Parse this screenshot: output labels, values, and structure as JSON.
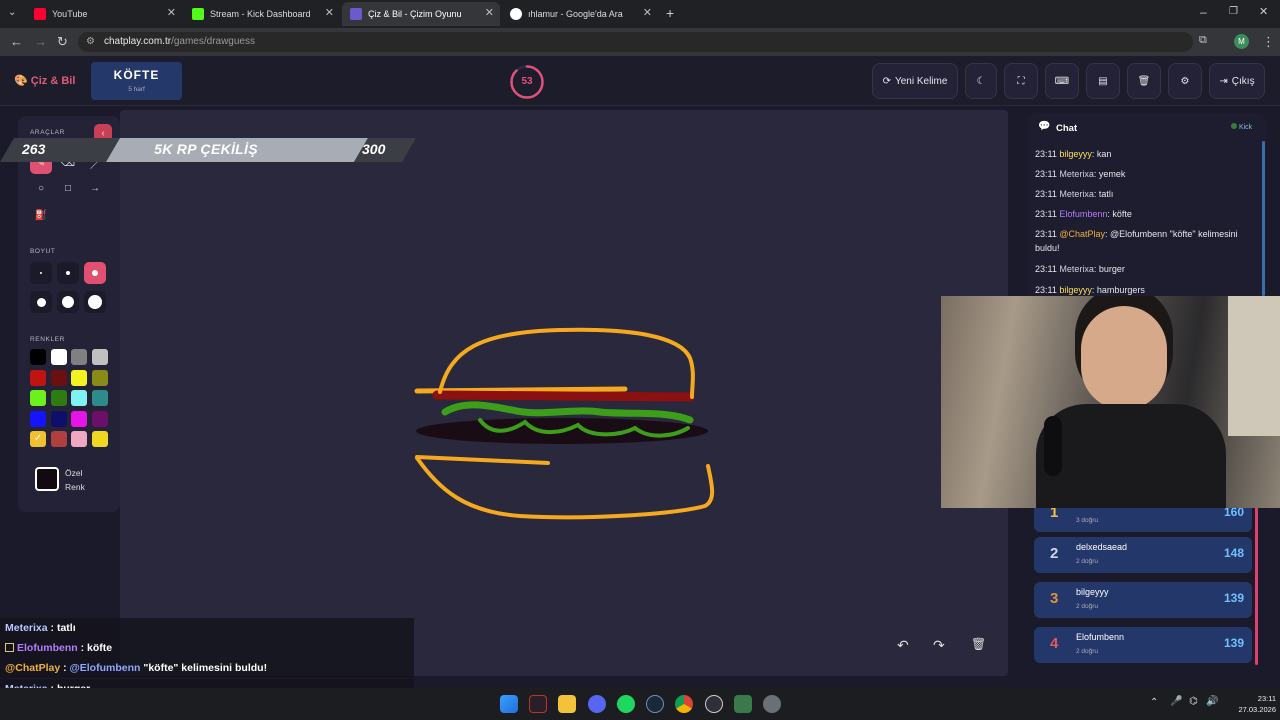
{
  "browser": {
    "tabs": [
      {
        "title": "YouTube",
        "color": "#ff0033"
      },
      {
        "title": "Stream - Kick Dashboard",
        "color": "#53fc18"
      },
      {
        "title": "Çiz & Bil - Çizim Oyunu",
        "color": "#6a5acd"
      },
      {
        "title": "ıhlamur - Google'da Ara",
        "color": "#ffffff"
      }
    ],
    "url_host": "chatplay.com.tr",
    "url_path": "/games/drawguess",
    "profile_letter": "M"
  },
  "app": {
    "logo": "Çiz & Bil",
    "word": "KÖFTE",
    "word_hint": "5 harf",
    "timer": "53",
    "timer_fraction": 0.88,
    "new_word_label": "Yeni Kelime",
    "logout_label": "Çıkış"
  },
  "tools": {
    "tools_heading": "ARAÇLAR",
    "size_heading": "BOYUT",
    "colors_heading": "RENKLER",
    "custom_color_line1": "Özel",
    "custom_color_line2": "Renk",
    "palette": [
      "#000000",
      "#ffffff",
      "#808080",
      "#c0c0c0",
      "#c01414",
      "#6b0f0f",
      "#f3f323",
      "#8a8a1a",
      "#6cf01e",
      "#2f7a12",
      "#7ff2f2",
      "#2f8a8a",
      "#1414ff",
      "#0f0f6b",
      "#e614e6",
      "#6b0f6b",
      "#f0c030",
      "#b04040",
      "#f0a8c0",
      "#f0d820"
    ]
  },
  "banner": {
    "left_value": "263",
    "title": "5K RP ÇEKİLİŞ",
    "right_value": "300"
  },
  "chat": {
    "title": "Chat",
    "source": "Kick",
    "messages": [
      {
        "time": "23:11",
        "user": "bilgeyyy",
        "text": "kan",
        "color": "#f6e05e"
      },
      {
        "time": "23:11",
        "user": "Meterixa",
        "text": "yemek",
        "color": "#d0d0e0"
      },
      {
        "time": "23:11",
        "user": "Meterixa",
        "text": "tatlı",
        "color": "#d0d0e0"
      },
      {
        "time": "23:11",
        "user": "Elofumbenn",
        "text": "köfte",
        "color": "#b47cff"
      },
      {
        "time": "23:11",
        "user": "@ChatPlay",
        "text": "@Elofumbenn \"köfte\" kelimesini buldu!",
        "color": "#f0b040"
      },
      {
        "time": "23:11",
        "user": "Meterixa",
        "text": "burger",
        "color": "#d0d0e0"
      },
      {
        "time": "23:11",
        "user": "bilgeyyy",
        "text": "hamburgers",
        "color": "#f6e05e"
      }
    ]
  },
  "leaderboard": [
    {
      "rank": "1",
      "name": "",
      "count": "3 doğru",
      "score": "160",
      "rank_color": "#f6c143"
    },
    {
      "rank": "2",
      "name": "delxedsaead",
      "count": "2 doğru",
      "score": "148",
      "rank_color": "#d0d6e6"
    },
    {
      "rank": "3",
      "name": "bilgeyyy",
      "count": "2 doğru",
      "score": "139",
      "rank_color": "#e0903a"
    },
    {
      "rank": "4",
      "name": "Elofumbenn",
      "count": "2 doğru",
      "score": "139",
      "rank_color": "#e05a5a"
    }
  ],
  "overlay_chat": [
    {
      "user": "Meterixa",
      "sep": " : ",
      "text": "tatlı",
      "color": "#b9c8ff",
      "badge": false
    },
    {
      "user": "Elofumbenn",
      "sep": " : ",
      "text": "köfte",
      "color": "#b47cff",
      "badge": true
    },
    {
      "user": "@ChatPlay",
      "sep": " : ",
      "text": "\"köfte\" kelimesini buldu!",
      "mention": "@Elofumbenn",
      "color": "#f0b040",
      "badge": false
    },
    {
      "user": "Meterixa",
      "sep": " : ",
      "text": "burger",
      "color": "#b9c8ff",
      "badge": false
    },
    {
      "user": "bilgeyyy",
      "sep": " : ",
      "text": "hamburgers",
      "color": "#f6e05e",
      "badge": true
    }
  ],
  "taskbar": {
    "time": "23:11",
    "date": "27.03.2026"
  }
}
